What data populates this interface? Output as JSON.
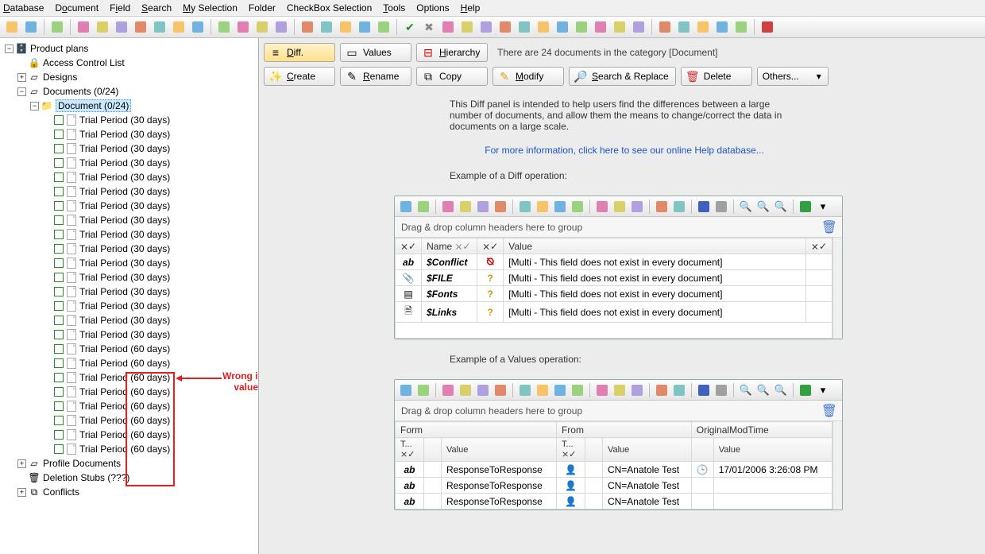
{
  "menu": {
    "items": [
      "Database",
      "Document",
      "Field",
      "Search",
      "My Selection",
      "Folder",
      "CheckBox Selection",
      "Tools",
      "Options",
      "Help"
    ],
    "accel": [
      "D",
      "o",
      "i",
      "S",
      "M",
      "",
      "",
      "T",
      "",
      "H"
    ]
  },
  "tree": {
    "root": "Product plans",
    "acl": "Access Control List",
    "designs": "Designs",
    "documents_label": "Documents  (0/24)",
    "document_node": "Document  (0/24)",
    "profile_docs": "Profile Documents",
    "deletion_stubs": "Deletion Stubs  (???)",
    "conflicts": "Conflicts",
    "docs30": "Trial Period (30 days)",
    "docs60_pre": "Trial Period ",
    "docs60_boxed": "(60 days)",
    "count30": 16,
    "count60": 8
  },
  "annotation": {
    "label_line1": "Wrong item",
    "label_line2": "values"
  },
  "right": {
    "top_buttons": {
      "diff": "Diff.",
      "values": "Values",
      "hierarchy": "Hierarchy"
    },
    "status": "There are 24 documents in the category [Document]",
    "action_buttons": [
      "Create",
      "Rename",
      "Copy",
      "Modify",
      "Search & Replace",
      "Delete",
      "Others..."
    ],
    "action_accel": [
      "C",
      "R",
      "",
      "M",
      "S",
      "",
      ""
    ],
    "intro_p1": "This Diff panel is intended to help users find the differences between a large number of documents, and allow them the means to change/correct the data in documents on a large scale.",
    "intro_link": "For more information, click here to see our online Help database...",
    "heading_diff": "Example of a Diff operation:",
    "heading_values": "Example of a Values operation:",
    "drag_hint": "Drag & drop column headers here to group",
    "diff_table": {
      "cols": [
        "",
        "Name",
        "",
        "",
        "Value",
        ""
      ],
      "rows": [
        {
          "name": "$Conflict",
          "value": "[Multi - This field does not exist in every document]",
          "sym": "⦰"
        },
        {
          "name": "$FILE",
          "value": "[Multi - This field does not exist in every document]",
          "sym": "?"
        },
        {
          "name": "$Fonts",
          "value": "[Multi - This field does not exist in every document]",
          "sym": "?"
        },
        {
          "name": "$Links",
          "value": "[Multi - This field does not exist in every document]",
          "sym": "?"
        }
      ]
    },
    "values_table": {
      "groups": [
        "Form",
        "From",
        "OriginalModTime"
      ],
      "subcols": [
        "T...",
        "",
        "Value",
        "T...",
        "",
        "Value",
        "",
        "Value"
      ],
      "rows": [
        {
          "form": "ResponseToResponse",
          "from": "CN=Anatole Test",
          "time": "17/01/2006 3:26:08 PM"
        },
        {
          "form": "ResponseToResponse",
          "from": "CN=Anatole Test",
          "time": ""
        },
        {
          "form": "ResponseToResponse",
          "from": "CN=Anatole Test",
          "time": ""
        }
      ]
    }
  }
}
